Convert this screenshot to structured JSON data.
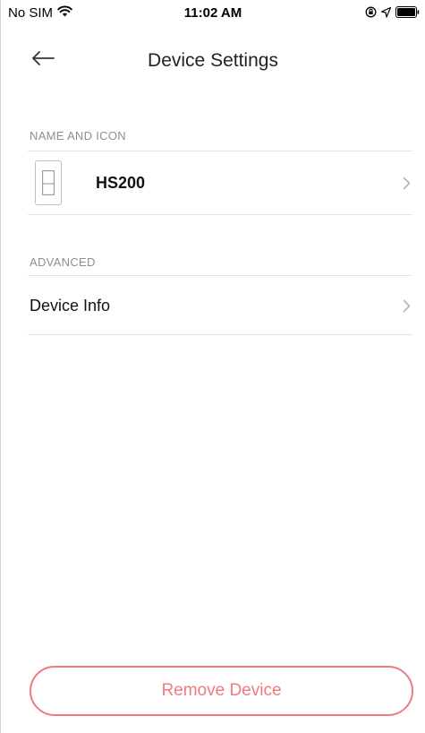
{
  "status_bar": {
    "carrier": "No SIM",
    "time": "11:02 AM",
    "icons": [
      "wifi-icon",
      "orientation-lock-icon",
      "location-icon",
      "battery-icon"
    ]
  },
  "nav": {
    "back_icon": "arrow-left-icon",
    "title": "Device Settings"
  },
  "sections": {
    "name_and_icon": {
      "header": "NAME AND ICON",
      "device_icon": "light-switch-icon",
      "device_name": "HS200"
    },
    "advanced": {
      "header": "ADVANCED",
      "device_info_label": "Device Info"
    }
  },
  "actions": {
    "remove_label": "Remove Device"
  },
  "colors": {
    "accent_red": "#f07a7e",
    "section_header": "#8e8e8e",
    "divider": "#e2e2e2",
    "chevron": "#b5b5b5"
  }
}
